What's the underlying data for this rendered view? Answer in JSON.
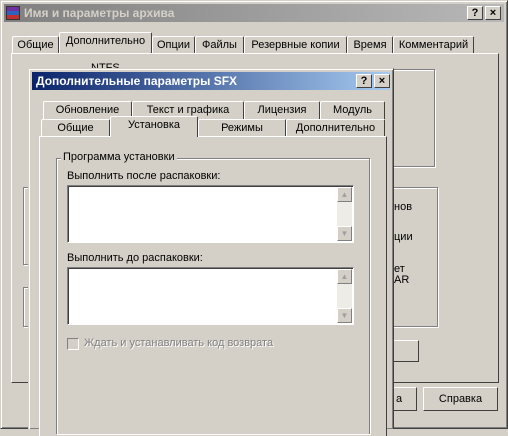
{
  "back_window": {
    "title": "Имя и параметры архива",
    "tabs": [
      "Общие",
      "Дополнительно",
      "Опции",
      "Файлы",
      "Резервные копии",
      "Время",
      "Комментарий"
    ],
    "fragment_top": "NTFS",
    "fragments_right": [
      "нов",
      "ции",
      "ет",
      "AR"
    ],
    "fragment_button": "а",
    "help_button": "Справка"
  },
  "dialog": {
    "title": "Дополнительные параметры SFX",
    "tabs_row1": [
      "Обновление",
      "Текст и графика",
      "Лицензия",
      "Модуль"
    ],
    "tabs_row2": [
      "Общие",
      "Установка",
      "Режимы",
      "Дополнительно"
    ],
    "selected_tab": "Установка",
    "group_title": "Программа установки",
    "after_label": "Выполнить после распаковки:",
    "before_label": "Выполнить до распаковки:",
    "after_value": "",
    "before_value": "",
    "wait_checkbox_label": "Ждать и устанавливать код возврата",
    "wait_checkbox_checked": false
  },
  "caption_buttons": {
    "help": "?",
    "close": "×"
  }
}
